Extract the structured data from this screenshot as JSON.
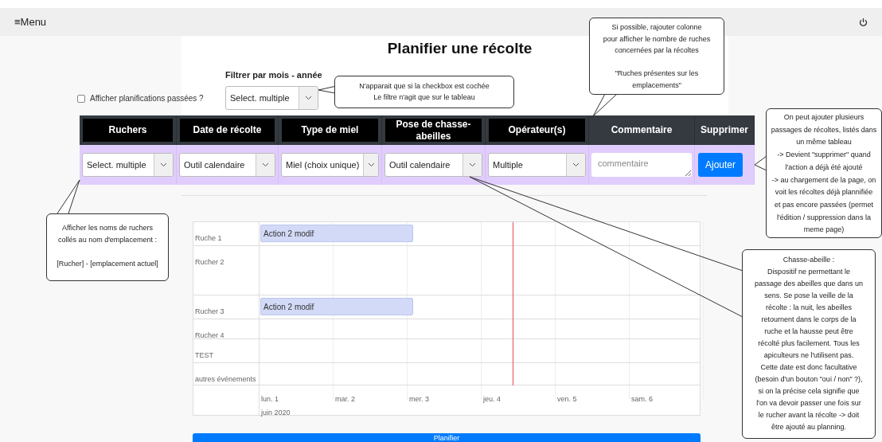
{
  "menu": {
    "label": "≡Menu"
  },
  "title": "Planifier une récolte",
  "past_toggle": {
    "label": "Afficher planifications passées ?",
    "checked": false
  },
  "filter": {
    "label": "Filtrer par mois - année",
    "value": "Select. multiple"
  },
  "table": {
    "columns": [
      {
        "label": "Ruchers",
        "boxed": true
      },
      {
        "label": "Date de récolte",
        "boxed": true
      },
      {
        "label": "Type de miel",
        "boxed": true
      },
      {
        "label": "Pose de chasse-abeilles",
        "boxed": true
      },
      {
        "label": "Opérateur(s)",
        "boxed": true
      },
      {
        "label": "Commentaire",
        "boxed": false
      },
      {
        "label": "Supprimer",
        "boxed": false
      }
    ],
    "row": [
      {
        "kind": "select",
        "value": "Select. multiple"
      },
      {
        "kind": "select",
        "value": "Outil calendaire"
      },
      {
        "kind": "select",
        "value": "Miel (choix unique)"
      },
      {
        "kind": "select",
        "value": "Outil calendaire"
      },
      {
        "kind": "select",
        "value": "Multiple"
      },
      {
        "kind": "textarea",
        "placeholder": "commentaire"
      },
      {
        "kind": "button",
        "label": "Ajouter"
      }
    ]
  },
  "calendar": {
    "rows": [
      {
        "label": "Ruche 1",
        "event": "Action 2 modif"
      },
      {
        "label": "Rucher 2"
      },
      {
        "label": "Rucher 3",
        "event": "Action 2 modif"
      },
      {
        "label": "Rucher 4"
      },
      {
        "label": "TEST"
      },
      {
        "label": "autres événements"
      }
    ],
    "days": [
      "lun. 1",
      "mar. 2",
      "mer. 3",
      "jeu. 4",
      "ven. 5",
      "sam. 6"
    ],
    "month": "juin 2020"
  },
  "submit": {
    "label": "Planifier"
  },
  "annotations": [
    {
      "text": "N'apparait que si la checkbox est cochée\nLe filtre n'agit que sur le tableau"
    },
    {
      "text": "Si possible, rajouter colonne\npour afficher le nombre de ruches\nconcernées par la récoltes\n\n\"Ruches présentes sur les\nemplacements\""
    },
    {
      "text": "On peut ajouter plusieurs\npassages de récoltes, listés dans\nun même tableau\n-> Devient \"supprimer\" quand\nl'action a déjà été ajouté\n-> au chargement de la page, on\nvoit les récoltes déjà plannifiée\net pas encore passées (permet\nl'édition / suppression dans la\nmeme page)"
    },
    {
      "text": "Afficher les noms de ruchers\ncollés au nom d'emplacement :\n\n[Rucher] - [emplacement actuel]"
    },
    {
      "text": "Chasse-abeille :\nDispositif ne permettant le\npassage des abeilles que dans un\nsens. Se pose la veille de la\nrécolte : la nuit, les abeilles\nretournent dans le corps de la\nruche et la hausse peut être\nrécolté plus facilement. Tous les\napiculteurs ne l'utilisent pas.\nCette date est donc facultative\n(besoin d'un bouton \"oui / non\" ?),\nsi on la précise cela signifie que\nl'on va devoir passer une fois sur\nle rucher avant la récolte -> doit\nêtre ajouté au planning."
    }
  ]
}
